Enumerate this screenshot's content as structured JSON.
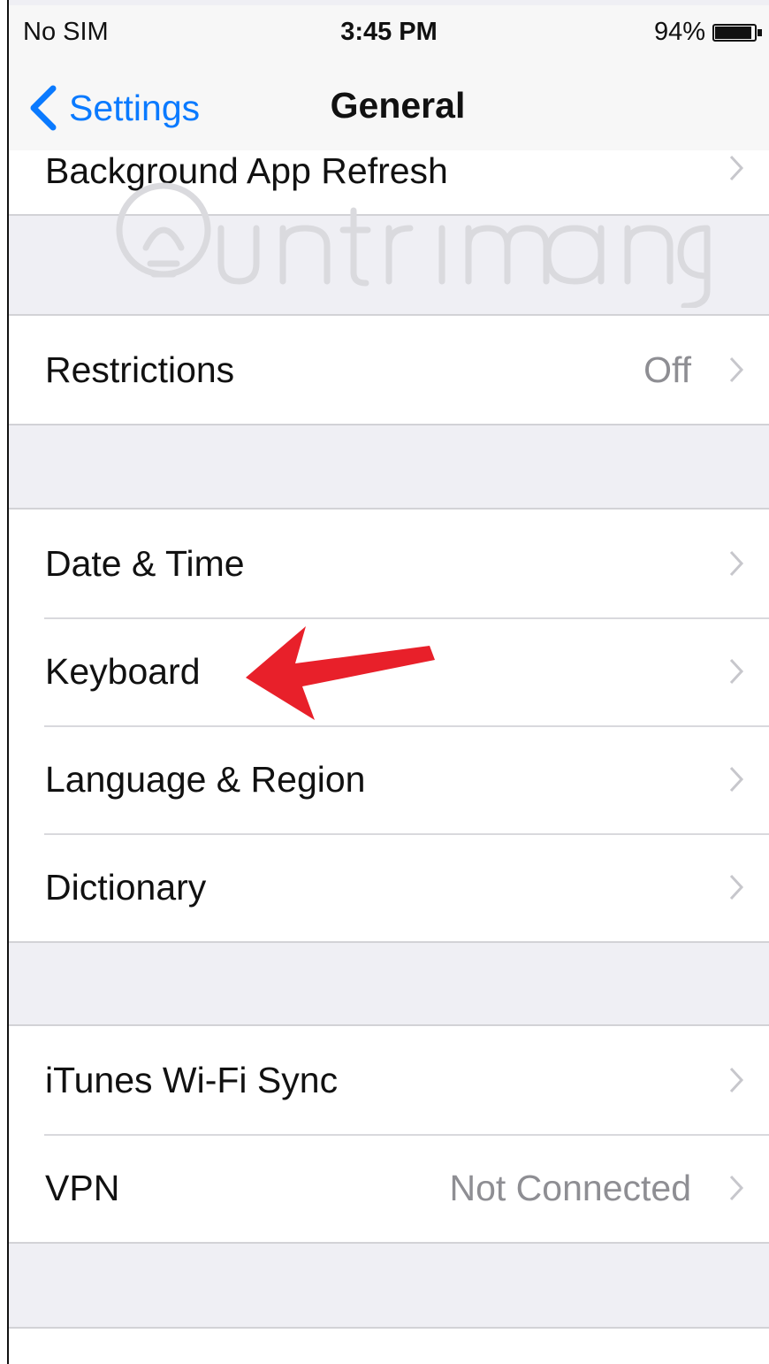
{
  "status_bar": {
    "carrier": "No SIM",
    "time": "3:45 PM",
    "battery_percent": "94%",
    "battery_level": 0.94
  },
  "nav": {
    "back_label": "Settings",
    "title": "General",
    "back_icon": "chevron-left-icon"
  },
  "groups": [
    {
      "rows": [
        {
          "label": "Background App Refresh",
          "value": ""
        }
      ]
    },
    {
      "rows": [
        {
          "label": "Restrictions",
          "value": "Off"
        }
      ]
    },
    {
      "rows": [
        {
          "label": "Date & Time",
          "value": ""
        },
        {
          "label": "Keyboard",
          "value": ""
        },
        {
          "label": "Language & Region",
          "value": ""
        },
        {
          "label": "Dictionary",
          "value": ""
        }
      ]
    },
    {
      "rows": [
        {
          "label": "iTunes Wi-Fi Sync",
          "value": ""
        },
        {
          "label": "VPN",
          "value": "Not Connected"
        }
      ]
    }
  ],
  "colors": {
    "accent": "#0a7aff",
    "background": "#efeff4",
    "secondary_text": "#8e8e93",
    "annotation": "#e8202a"
  },
  "icons": {
    "row_chevron": "chevron-right-icon",
    "annotation": "arrow-left-icon",
    "watermark": "lightbulb-icon"
  }
}
